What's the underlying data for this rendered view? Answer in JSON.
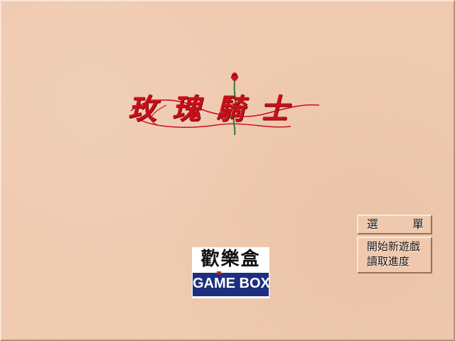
{
  "title": {
    "text": "玫瑰騎士",
    "color": "#c8101a"
  },
  "publisher": {
    "chinese_name": "歡樂盒",
    "english_name": "GAME BOX",
    "band_color": "#1d2f7e"
  },
  "menu": {
    "header_chars": [
      "選",
      "單"
    ],
    "items": [
      {
        "label": "開始新遊戲"
      },
      {
        "label": "讀取進度"
      }
    ]
  },
  "colors": {
    "background": "#f1cbb0",
    "menu_text": "#1b0e08"
  }
}
